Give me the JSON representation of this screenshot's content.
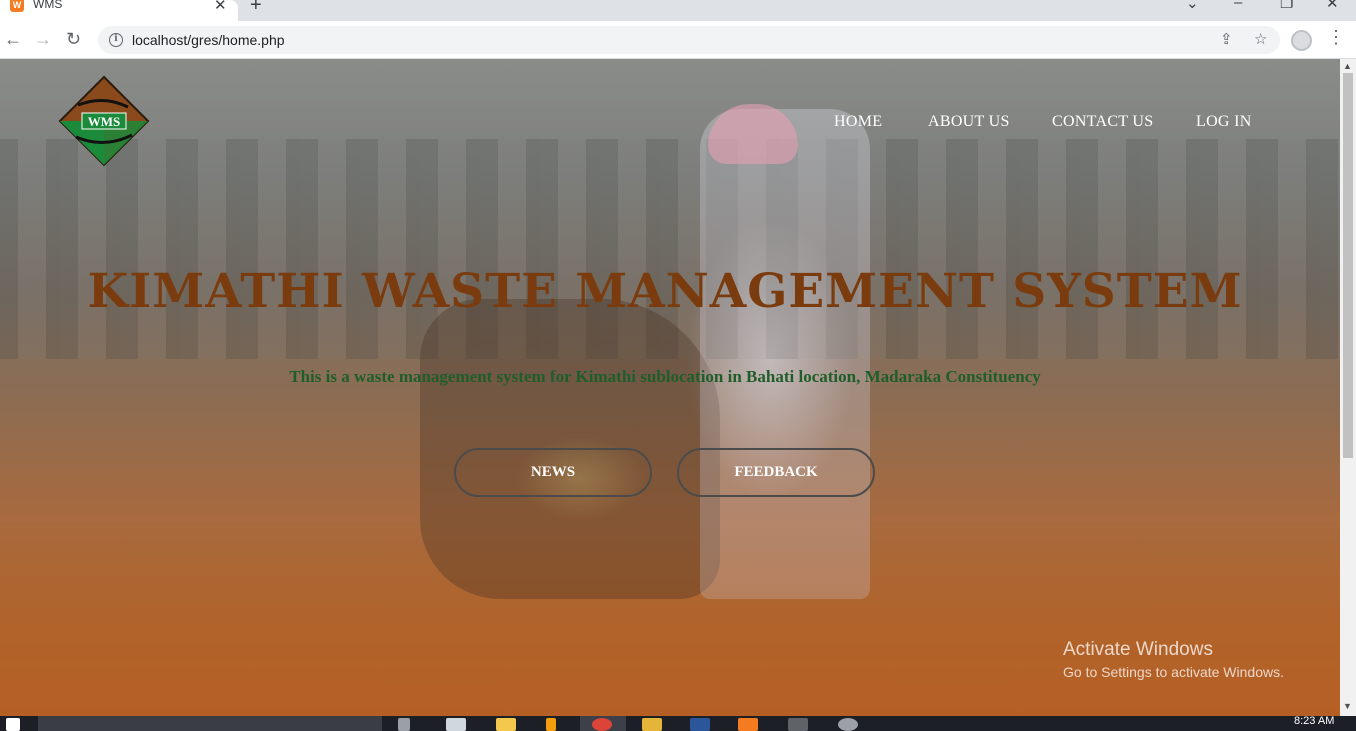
{
  "browser": {
    "tab_title": "WMS",
    "tab_favicon_text": "W",
    "url": "localhost/gres/home.php"
  },
  "nav": {
    "links": [
      "HOME",
      "ABOUT US",
      "CONTACT US",
      "LOG IN"
    ]
  },
  "hero": {
    "title": "KIMATHI WASTE MANAGEMENT SYSTEM",
    "subtitle": "This is a waste management system for Kimathi sublocation in Bahati location, Madaraka Constituency",
    "buttons": [
      "NEWS",
      "FEEDBACK"
    ]
  },
  "logo": {
    "text": "WMS"
  },
  "watermark": {
    "title": "Activate Windows",
    "subtitle": "Go to Settings to activate Windows."
  },
  "taskbar": {
    "clock": "8:23 AM"
  },
  "colors": {
    "title": "#7a3c0e",
    "subtitle": "#1f5e2a",
    "logo_brown": "#8b4a1c",
    "logo_green": "#1b8a3a"
  }
}
